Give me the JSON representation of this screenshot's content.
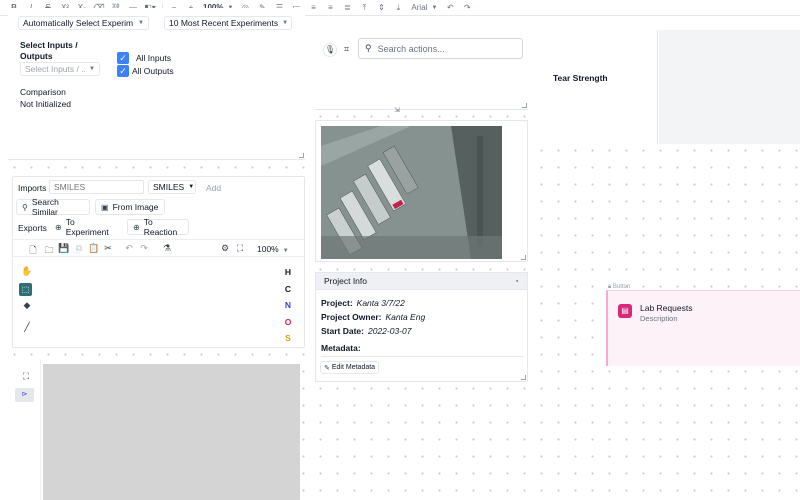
{
  "toolbar": {
    "bold": "B",
    "italic": "I",
    "strike": "S",
    "superscript": "X²",
    "subscript": "X₂",
    "zoom": "100%",
    "font": "Arial"
  },
  "experiment_selector": {
    "mode": "Automatically Select Experim",
    "recent": "10 Most Recent Experiments"
  },
  "inputs_outputs": {
    "label": "Select Inputs / Outputs",
    "placeholder": "Select Inputs / ...",
    "all_inputs": "All Inputs",
    "all_outputs": "All Outputs",
    "comparison_status": "Comparison Not Initialized"
  },
  "chem_editor": {
    "imports_label": "Imports",
    "smiles_placeholder": "SMILES",
    "format": "SMILES",
    "add": "Add",
    "search_similar": "Search Similar",
    "from_image": "From Image",
    "exports_label": "Exports",
    "to_experiment": "To Experiment",
    "to_reaction": "To Reaction",
    "zoom": "100%",
    "atoms": [
      {
        "symbol": "H",
        "color": "#111827"
      },
      {
        "symbol": "C",
        "color": "#111827"
      },
      {
        "symbol": "N",
        "color": "#3b3bd6"
      },
      {
        "symbol": "O",
        "color": "#e11d48"
      },
      {
        "symbol": "S",
        "color": "#d4a017"
      }
    ]
  },
  "actions": {
    "search_placeholder": "Search actions..."
  },
  "project_info": {
    "header": "Project Info",
    "project_label": "Project:",
    "project_value": "Kanta 3/7/22",
    "owner_label": "Project Owner:",
    "owner_value": "Kanta Eng",
    "start_label": "Start Date:",
    "start_value": "2022-03-07",
    "metadata_label": "Metadata:",
    "edit_metadata": "Edit Metadata"
  },
  "tear_strength": {
    "title": "Tear Strength"
  },
  "lab_requests": {
    "tag": "Button",
    "title": "Lab Requests",
    "description": "Description"
  }
}
